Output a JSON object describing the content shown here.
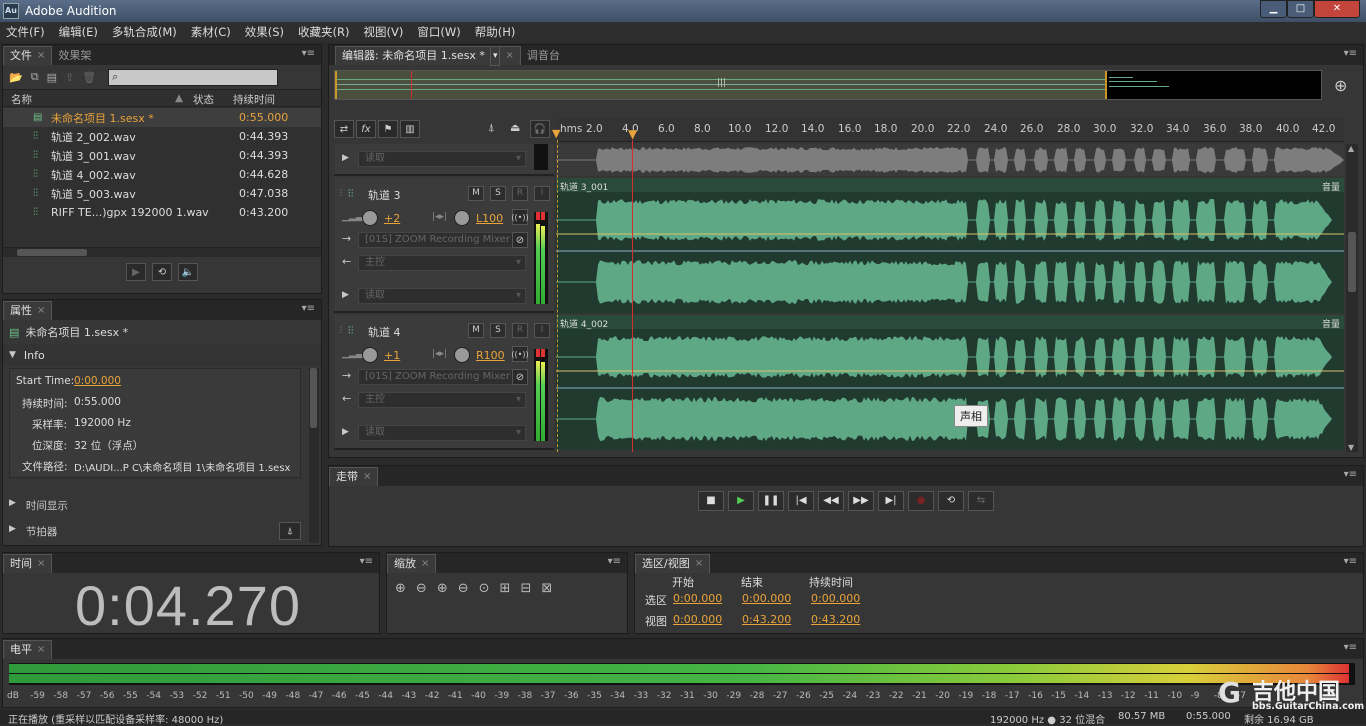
{
  "app": {
    "title": "Adobe Audition",
    "logo": "Au"
  },
  "menu": [
    "文件(F)",
    "编辑(E)",
    "多轨合成(M)",
    "素材(C)",
    "效果(S)",
    "收藏夹(R)",
    "视图(V)",
    "窗口(W)",
    "帮助(H)"
  ],
  "files_panel": {
    "tabs": [
      "文件",
      "效果架"
    ],
    "columns": {
      "name": "名称",
      "status": "状态",
      "duration": "持续时间"
    },
    "items": [
      {
        "name": "未命名项目 1.sesx *",
        "duration": "0:55.000",
        "type": "session"
      },
      {
        "name": "轨道 2_002.wav",
        "duration": "0:44.393",
        "type": "wav"
      },
      {
        "name": "轨道 3_001.wav",
        "duration": "0:44.393",
        "type": "wav"
      },
      {
        "name": "轨道 4_002.wav",
        "duration": "0:44.628",
        "type": "wav"
      },
      {
        "name": "轨道 5_003.wav",
        "duration": "0:47.038",
        "type": "wav"
      },
      {
        "name": "RIFF TE...)gpx 192000 1.wav",
        "duration": "0:43.200",
        "type": "wav"
      }
    ]
  },
  "properties_panel": {
    "tab": "属性",
    "file": "未命名项目 1.sesx *",
    "section": "Info",
    "start_label": "Start Time:",
    "start_value": "0:00.000",
    "duration_label": "持续时间:",
    "duration_value": "0:55.000",
    "rate_label": "采样率:",
    "rate_value": "192000 Hz",
    "depth_label": "位深度:",
    "depth_value": "32 位（浮点）",
    "path_label": "文件路径:",
    "path_value": "D:\\AUDI...P C\\未命名项目 1\\未命名项目 1.sesx",
    "time_display": "时间显示",
    "metronome": "节拍器"
  },
  "editor": {
    "tabs": [
      "编辑器: 未命名项目 1.sesx *",
      "调音台"
    ],
    "ruler_unit": "hms",
    "ruler": [
      "2.0",
      "4.0",
      "6.0",
      "8.0",
      "10.0",
      "12.0",
      "14.0",
      "16.0",
      "18.0",
      "20.0",
      "22.0",
      "24.0",
      "26.0",
      "28.0",
      "30.0",
      "32.0",
      "34.0",
      "36.0",
      "38.0",
      "40.0",
      "42.0"
    ],
    "read_label": "读取",
    "tracks": [
      {
        "name": "轨道 3",
        "volume": "+2",
        "pan": "L100",
        "input": "[01S] ZOOM Recording Mixer",
        "output": "主控",
        "read": "读取",
        "clip": "轨道 3_001",
        "clip_label": "音量"
      },
      {
        "name": "轨道 4",
        "volume": "+1",
        "pan": "R100",
        "input": "[01S] ZOOM Recording Mixer",
        "output": "主控",
        "read": "读取",
        "clip": "轨道 4_002",
        "clip_label": "音量"
      }
    ],
    "tooltip": "声相",
    "mute": "M",
    "solo": "S",
    "rec": "R",
    "input_mon": "I"
  },
  "transport": {
    "tab": "走带"
  },
  "time_panel": {
    "tab": "时间",
    "value": "0:04.270"
  },
  "zoom_panel": {
    "tab": "缩放"
  },
  "selection_panel": {
    "tab": "选区/视图",
    "col_start": "开始",
    "col_end": "结束",
    "col_duration": "持续时间",
    "row_selection": "选区",
    "row_view": "视图",
    "sel_start": "0:00.000",
    "sel_end": "0:00.000",
    "sel_dur": "0:00.000",
    "view_start": "0:00.000",
    "view_end": "0:43.200",
    "view_dur": "0:43.200"
  },
  "level_panel": {
    "tab": "电平",
    "scale": [
      "dB",
      "-59",
      "-58",
      "-57",
      "-56",
      "-55",
      "-54",
      "-53",
      "-52",
      "-51",
      "-50",
      "-49",
      "-48",
      "-47",
      "-46",
      "-45",
      "-44",
      "-43",
      "-42",
      "-41",
      "-40",
      "-39",
      "-38",
      "-37",
      "-36",
      "-35",
      "-34",
      "-33",
      "-32",
      "-31",
      "-30",
      "-29",
      "-28",
      "-27",
      "-26",
      "-25",
      "-24",
      "-23",
      "-22",
      "-21",
      "-20",
      "-19",
      "-18",
      "-17",
      "-16",
      "-15",
      "-14",
      "-13",
      "-12",
      "-11",
      "-10",
      "-9",
      "-8",
      "-7"
    ]
  },
  "watermark": {
    "line1": "吉他中国",
    "line2": "bbs.GuitarChina.com"
  },
  "status": {
    "left": "正在播放 (重采样以匹配设备采样率: 48000 Hz)",
    "format": "192000 Hz ● 32 位混合",
    "size": "80.57 MB",
    "time": "0:55.000",
    "free": "剩余 16.94 GB"
  },
  "colors": {
    "accent": "#e8a33a",
    "wave": "#5fa886",
    "clipbg": "#203a2f",
    "playhead": "#d03030"
  }
}
